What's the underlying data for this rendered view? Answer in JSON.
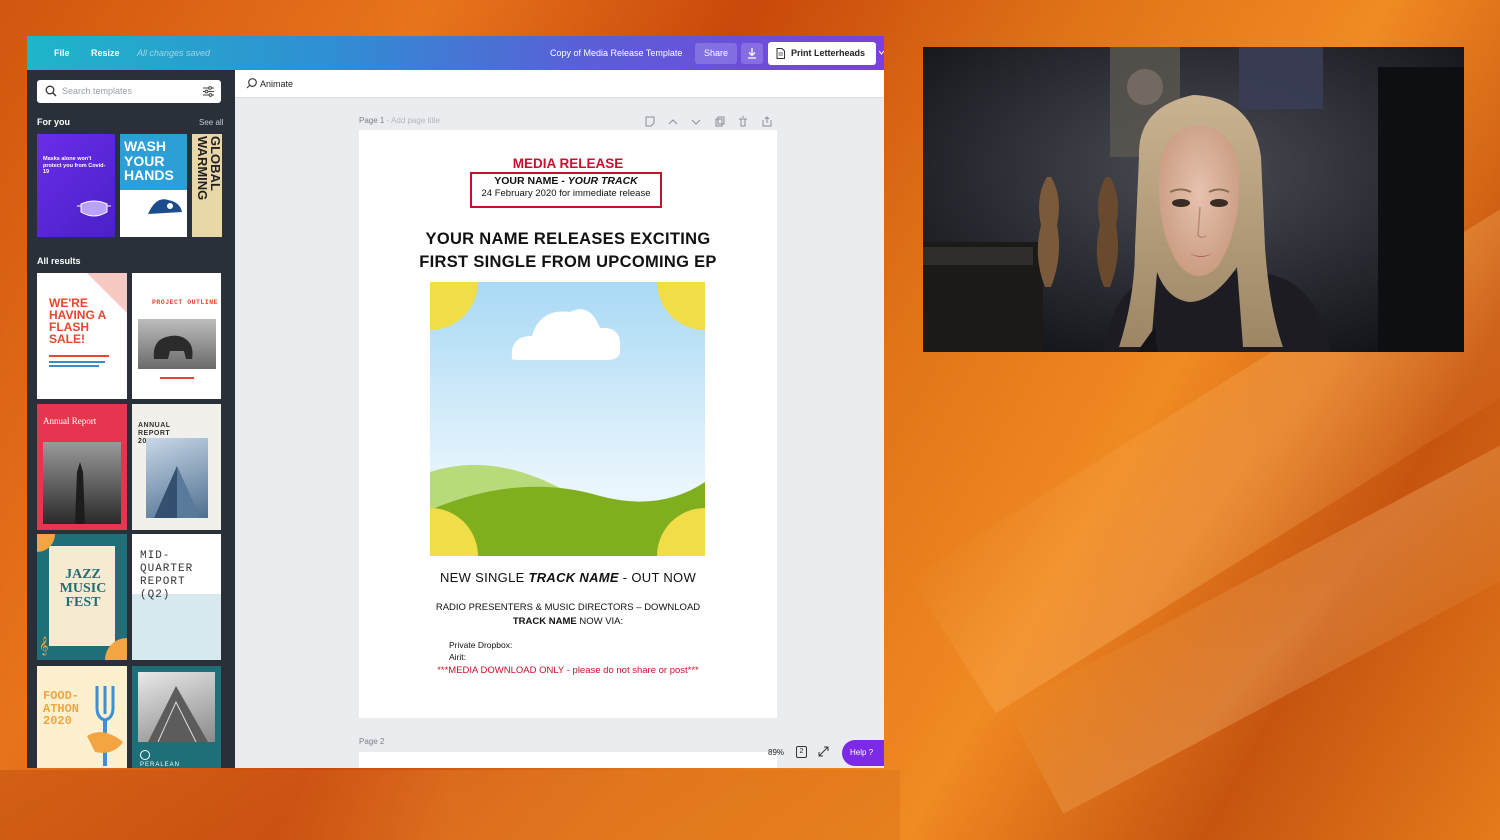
{
  "topbar": {
    "file": "File",
    "resize": "Resize",
    "saved_status": "All changes saved",
    "document_title": "Copy of Media Release Template",
    "share": "Share",
    "print": "Print Letterheads"
  },
  "sidebar": {
    "search_placeholder": "Search templates",
    "for_you": "For you",
    "see_all": "See all",
    "all_results": "All results",
    "for_you_thumbs": [
      {
        "title": "Masks alone won't protect you from Covid-19",
        "name": "covid-masks-template"
      },
      {
        "title": "WASH YOUR HANDS",
        "name": "wash-hands-template"
      },
      {
        "title": "GLOBAL WARMING",
        "name": "global-warming-template"
      }
    ],
    "results": [
      {
        "title": "WE'RE HAVING A FLASH SALE!"
      },
      {
        "title": "PROJECT OUTLINE"
      },
      {
        "title": "Annual Report"
      },
      {
        "title": "ANNUAL REPORT 2020"
      },
      {
        "title": "JAZZ MUSIC FEST"
      },
      {
        "title": "MID-QUARTER REPORT (Q2)"
      },
      {
        "title": "FOOD-ATHON 2020"
      },
      {
        "title": "PERALEAN"
      }
    ]
  },
  "editor": {
    "animate": "Animate",
    "page1_label": "Page 1",
    "page1_sub": " - Add page title",
    "page2_label": "Page 2",
    "zoom": "89%",
    "page_count": "2",
    "help": "Help  ?"
  },
  "document": {
    "media_release": "MEDIA RELEASE",
    "name_prefix": "YOUR NAME - ",
    "name_track": "YOUR TRACK",
    "date_line": "24 February 2020 for immediate release",
    "headline_1": "YOUR NAME RELEASES EXCITING",
    "headline_2": "FIRST SINGLE FROM UPCOMING EP",
    "single_prefix": "NEW SINGLE ",
    "single_track": "TRACK NAME",
    "single_suffix": " - OUT NOW",
    "radio_line1": "RADIO PRESENTERS & MUSIC DIRECTORS – DOWNLOAD",
    "radio_track": "TRACK NAME",
    "radio_suffix": " NOW VIA:",
    "dropbox": "Private Dropbox:",
    "airit": "Airit:",
    "warning": "***MEDIA DOWNLOAD ONLY - please do not share or post***"
  },
  "colors": {
    "accent_red": "#c8102e",
    "sidebar_bg": "#293039",
    "help_purple": "#7d2ae8"
  }
}
